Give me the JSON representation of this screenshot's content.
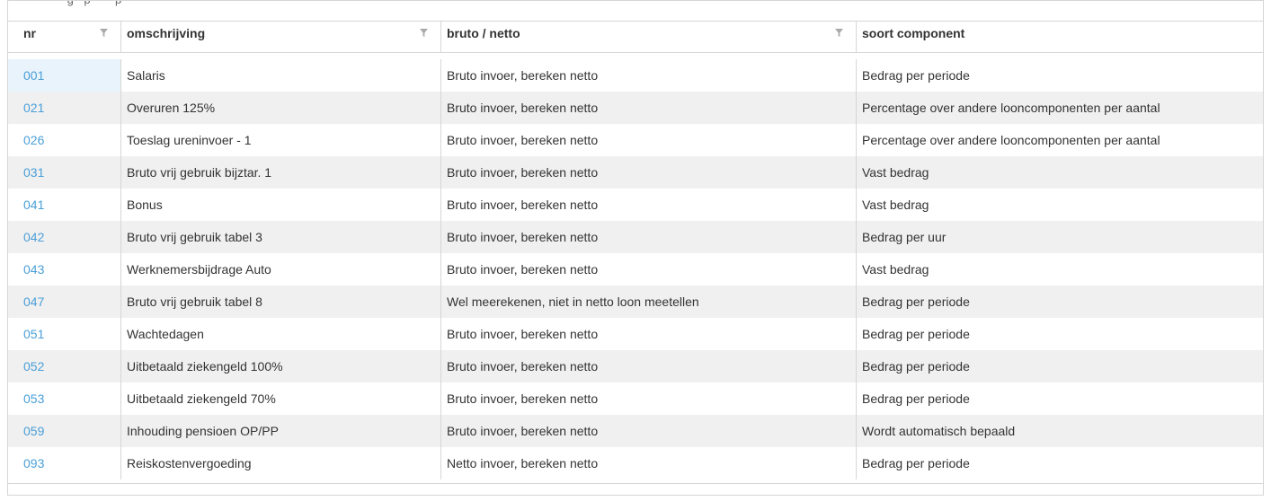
{
  "top_text": "- - - - - - - g - p - - - p - -",
  "columns": [
    {
      "label": "nr"
    },
    {
      "label": "omschrijving"
    },
    {
      "label": "bruto / netto"
    },
    {
      "label": "soort component"
    }
  ],
  "rows": [
    {
      "nr": "001",
      "omschrijving": "Salaris",
      "bruto_netto": "Bruto invoer, bereken netto",
      "soort": "Bedrag per periode"
    },
    {
      "nr": "021",
      "omschrijving": "Overuren 125%",
      "bruto_netto": "Bruto invoer, bereken netto",
      "soort": "Percentage over andere looncomponenten per aantal"
    },
    {
      "nr": "026",
      "omschrijving": "Toeslag ureninvoer - 1",
      "bruto_netto": "Bruto invoer, bereken netto",
      "soort": "Percentage over andere looncomponenten per aantal"
    },
    {
      "nr": "031",
      "omschrijving": "Bruto vrij gebruik bijztar. 1",
      "bruto_netto": "Bruto invoer, bereken netto",
      "soort": "Vast bedrag"
    },
    {
      "nr": "041",
      "omschrijving": "Bonus",
      "bruto_netto": "Bruto invoer, bereken netto",
      "soort": "Vast bedrag"
    },
    {
      "nr": "042",
      "omschrijving": "Bruto vrij gebruik tabel 3",
      "bruto_netto": "Bruto invoer, bereken netto",
      "soort": "Bedrag per uur"
    },
    {
      "nr": "043",
      "omschrijving": "Werknemersbijdrage Auto",
      "bruto_netto": "Bruto invoer, bereken netto",
      "soort": "Vast bedrag"
    },
    {
      "nr": "047",
      "omschrijving": "Bruto vrij gebruik tabel 8",
      "bruto_netto": "Wel meerekenen, niet in netto loon meetellen",
      "soort": "Bedrag per periode"
    },
    {
      "nr": "051",
      "omschrijving": "Wachtedagen",
      "bruto_netto": "Bruto invoer, bereken netto",
      "soort": "Bedrag per periode"
    },
    {
      "nr": "052",
      "omschrijving": "Uitbetaald ziekengeld 100%",
      "bruto_netto": "Bruto invoer, bereken netto",
      "soort": "Bedrag per periode"
    },
    {
      "nr": "053",
      "omschrijving": "Uitbetaald ziekengeld 70%",
      "bruto_netto": "Bruto invoer, bereken netto",
      "soort": "Bedrag per periode"
    },
    {
      "nr": "059",
      "omschrijving": "Inhouding pensioen OP/PP",
      "bruto_netto": "Bruto invoer, bereken netto",
      "soort": "Wordt automatisch bepaald"
    },
    {
      "nr": "093",
      "omschrijving": "Reiskostenvergoeding",
      "bruto_netto": "Netto invoer, bereken netto",
      "soort": "Bedrag per periode"
    }
  ],
  "colors": {
    "link": "#4a9fd8",
    "row_alt": "#f0f0f0",
    "border": "#d6d6d6",
    "filter_icon": "#aaaaaa"
  },
  "icons": {
    "filter": "filter-funnel-icon"
  }
}
